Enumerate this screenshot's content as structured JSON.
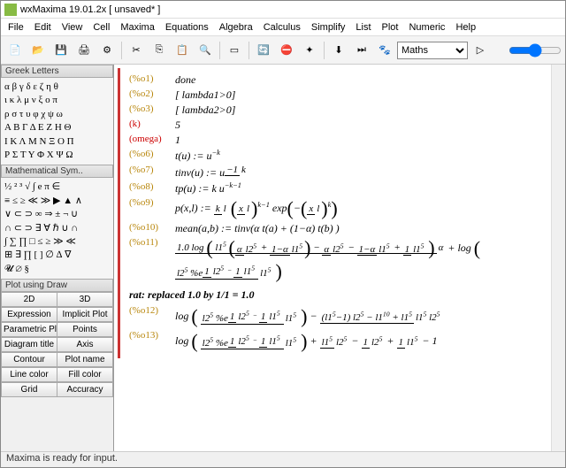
{
  "title": "wxMaxima 19.01.2x [ unsaved* ]",
  "menus": [
    "File",
    "Edit",
    "View",
    "Cell",
    "Maxima",
    "Equations",
    "Algebra",
    "Calculus",
    "Simplify",
    "List",
    "Plot",
    "Numeric",
    "Help"
  ],
  "toolbar": {
    "mode_select": "Maths",
    "icons": [
      "new-doc-icon",
      "open-icon",
      "save-icon",
      "print-icon",
      "settings-icon",
      "cut-icon",
      "copy-icon",
      "paste-icon",
      "find-icon",
      "select-icon",
      "refresh-icon",
      "stop-icon",
      "play-icon",
      "step-down-icon",
      "step-forward-icon",
      "animate-icon"
    ]
  },
  "panels": {
    "greek": {
      "title": "Greek Letters",
      "rows": [
        "α β γ δ ε ζ η θ",
        "ι κ λ μ ν ξ ο π",
        "ρ σ τ υ φ χ ψ ω",
        "Α Β Γ Δ Ε Ζ Η Θ",
        "Ι Κ Λ Μ Ν Ξ Ο Π",
        "Ρ Σ Τ Υ Φ Χ Ψ Ω"
      ]
    },
    "mathsym": {
      "title": "Mathematical Sym..",
      "rows": [
        "½  ²  ³  √  ∫  e  π  ∈",
        "≡  ≤  ≥  ≪  ≫  ▶  ▲  ∧",
        "∨  ⊂  ⊃  ∞  ⇒  ± ¬  ∪",
        "∩  ⊂  ⊃  ∃  ∀  ℏ  ∪  ∩",
        "∫  ∑  ∏  □  ≤  ≥  ≫  ≪",
        "⊞  ∃  ∏  [  ]  ∅  ∆  ∇",
        " 𝓤  ∅  §"
      ]
    },
    "plot": {
      "title": "Plot using Draw",
      "rows": [
        [
          "2D",
          "3D"
        ],
        [
          "Expression",
          "Implicit Plot"
        ],
        [
          "Parametric Pl",
          "Points"
        ],
        [
          "Diagram title",
          "Axis"
        ],
        [
          "Contour",
          "Plot name"
        ],
        [
          "Line color",
          "Fill color"
        ],
        [
          "Grid",
          "Accuracy"
        ]
      ]
    }
  },
  "outputs": [
    {
      "label": "(%o1)",
      "cls": "o",
      "text": "done"
    },
    {
      "label": "(%o2)",
      "cls": "o",
      "text": "[ lambda1>0]"
    },
    {
      "label": "(%o3)",
      "cls": "o",
      "text": "[ lambda2>0]"
    },
    {
      "label": "(k)",
      "cls": "r",
      "text": "5"
    },
    {
      "label": "(omega)",
      "cls": "r",
      "text": "1"
    },
    {
      "label": "(%o6)",
      "cls": "o",
      "html": "t(<i>u</i>) := <i>u</i><sup>−<i>k</i></sup>"
    },
    {
      "label": "(%o7)",
      "cls": "o",
      "html": "tinv(<i>u</i>) := <i>u</i><sup><span class='frac'><span class='n'>−1</span><span class='d'><i>k</i></span></span></sup>"
    },
    {
      "label": "(%o8)",
      "cls": "o",
      "html": "tp(<i>u</i>) := <i>k u</i><sup>−<i>k</i>−1</sup>"
    },
    {
      "label": "(%o9)",
      "cls": "o",
      "html": "p(<i>x</i>,<i>l</i>) := <span class='frac'><span class='n'><i>k</i></span><span class='d'><i>l</i></span></span> <span class='big'>(</span><span class='frac'><span class='n'><i>x</i></span><span class='d'><i>l</i></span></span><span class='big'>)</span><sup><i>k</i>−1</sup> exp<span class='big'>(</span>−<span class='big'>(</span><span class='frac'><span class='n'><i>x</i></span><span class='d'><i>l</i></span></span><span class='big'>)</span><sup><i>k</i></sup><span class='big'>)</span>"
    },
    {
      "label": "(%o10)",
      "cls": "o",
      "html": "mean(<i>a</i>,<i>b</i>) := tinv(<i>α</i> t(<i>a</i>) + (1−<i>α</i>) t(<i>b</i>) )"
    },
    {
      "label": "(%o11)",
      "cls": "o",
      "html": "<span class='frac'><span class='n'>1.0 log <span class='big'>(</span> <i>l1</i><sup>5</sup> <span class='big'>(</span><span class='frac'><span class='n'><i>α</i></span><span class='d'><i>l2</i><sup>5</sup></span></span> + <span class='frac'><span class='n'>1−<i>α</i></span><span class='d'><i>l1</i><sup>5</sup></span></span><span class='big'>)</span> − <span class='frac'><span class='n'><i>α</i></span><span class='d'><i>l2</i><sup>5</sup></span></span> − <span class='frac'><span class='n'>1−<i>α</i></span><span class='d'><i>l1</i><sup>5</sup></span></span> + <span class='frac'><span class='n'>1</span><span class='d'><i>l1</i><sup>5</sup></span></span> <span class='big'>)</span></span><span class='d'><i>α</i></span></span> + log <span class='big'>(</span> <span class='frac'><span class='n'><i>l2</i><sup>5</sup> %e<sup><span class='frac'><span class='n'>1</span><span class='d'><i>l2</i><sup>5</sup></span></span> − <span class='frac'><span class='n'>1</span><span class='d'><i>l1</i><sup>5</sup></span></span></sup></span><span class='d'><i>l1</i><sup>5</sup></span></span> <span class='big'>)</span>"
    },
    {
      "remark": "rat: replaced 1.0 by 1/1 = 1.0"
    },
    {
      "label": "(%o12)",
      "cls": "o",
      "html": "log <span class='big'>(</span> <span class='frac'><span class='n'><i>l2</i><sup>5</sup> %e<sup><span class='frac'><span class='n'>1</span><span class='d'><i>l2</i><sup>5</sup></span></span> − <span class='frac'><span class='n'>1</span><span class='d'><i>l1</i><sup>5</sup></span></span></sup></span><span class='d'><i>l1</i><sup>5</sup></span></span> <span class='big'>)</span> − <span class='frac'><span class='n'>(<i>l1</i><sup>5</sup>−1) <i>l2</i><sup>5</sup> − <i>l1</i><sup>10</sup> + <i>l1</i><sup>5</sup></span><span class='d'><i>l1</i><sup>5</sup> <i>l2</i><sup>5</sup></span></span>"
    },
    {
      "label": "(%o13)",
      "cls": "o",
      "html": "log <span class='big'>(</span> <span class='frac'><span class='n'><i>l2</i><sup>5</sup> %e<sup><span class='frac'><span class='n'>1</span><span class='d'><i>l2</i><sup>5</sup></span></span> − <span class='frac'><span class='n'>1</span><span class='d'><i>l1</i><sup>5</sup></span></span></sup></span><span class='d'><i>l1</i><sup>5</sup></span></span> <span class='big'>)</span> + <span class='frac'><span class='n'><i>l1</i><sup>5</sup></span><span class='d'><i>l2</i><sup>5</sup></span></span> − <span class='frac'><span class='n'>1</span><span class='d'><i>l2</i><sup>5</sup></span></span> + <span class='frac'><span class='n'>1</span><span class='d'><i>l1</i><sup>5</sup></span></span> − 1"
    }
  ],
  "status": "Maxima is ready for input."
}
